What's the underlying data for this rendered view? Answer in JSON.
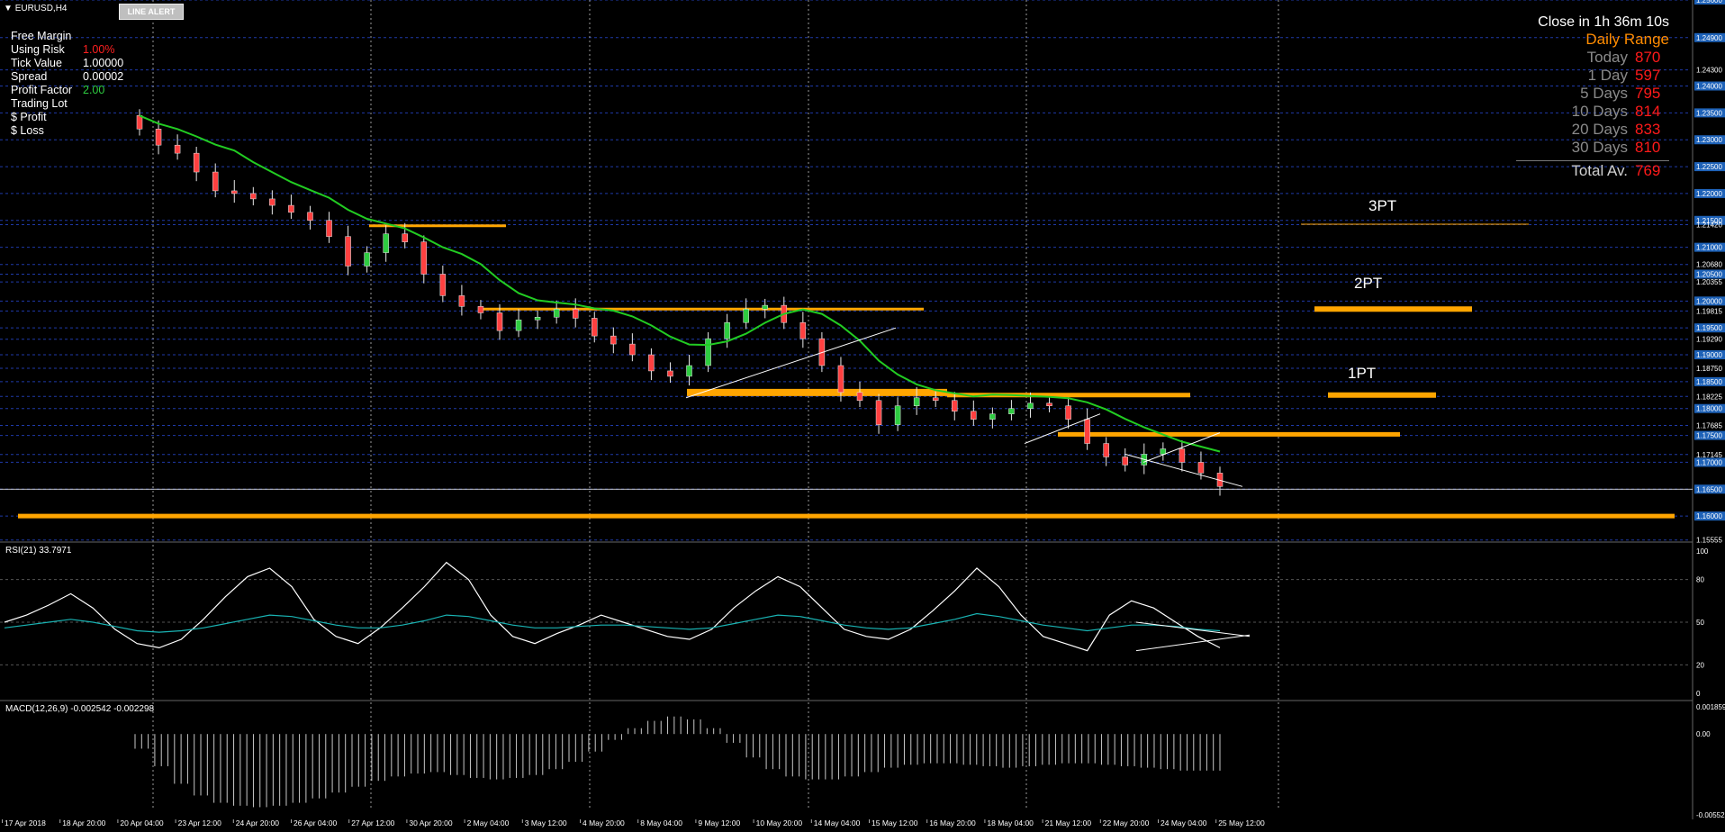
{
  "window": {
    "title": "EURUSD,H4",
    "alert_button": "LINE ALERT"
  },
  "info_panel": [
    {
      "label": "Free Margin",
      "value": ""
    },
    {
      "label": "Using Risk",
      "value": "1.00%",
      "color": "#ff2020"
    },
    {
      "label": "Tick Value",
      "value": "1.00000"
    },
    {
      "label": "Spread",
      "value": "0.00002"
    },
    {
      "label": "Profit Factor",
      "value": "2.00",
      "color": "#2ecc40"
    },
    {
      "label": "Trading Lot",
      "value": ""
    },
    {
      "label": "$ Profit",
      "value": ""
    },
    {
      "label": "$ Loss",
      "value": ""
    }
  ],
  "daily_range": {
    "close_timer": "Close in 1h 36m 10s",
    "title": "Daily Range",
    "rows": [
      {
        "label": "Today",
        "value": "870"
      },
      {
        "label": "1 Day",
        "value": "597"
      },
      {
        "label": "5 Days",
        "value": "795"
      },
      {
        "label": "10 Days",
        "value": "814"
      },
      {
        "label": "20 Days",
        "value": "833"
      },
      {
        "label": "30 Days",
        "value": "810"
      }
    ],
    "total_label": "Total Av.",
    "total_value": "769"
  },
  "targets": [
    {
      "label": "3PT",
      "price": 1.2143
    },
    {
      "label": "2PT",
      "price": 1.1985
    },
    {
      "label": "1PT",
      "price": 1.1825
    }
  ],
  "colors": {
    "up": "#2ecc40",
    "down": "#ff4040",
    "ma": "#22cc22",
    "level": "#ffa500",
    "grid": "#1f3aa8",
    "rsi": "#ffffff",
    "rsi_ma": "#19b3b3",
    "macd": "#c8c8c8"
  },
  "chart_data": [
    {
      "type": "line",
      "subtype": "candlestick",
      "symbol": "EURUSD",
      "timeframe": "H4",
      "ylim": [
        1.1555,
        1.256
      ],
      "price_ticks": [
        "1.25600",
        "1.24900",
        "1.24300",
        "1.24000",
        "1.23500",
        "1.23000",
        "1.22500",
        "1.22000",
        "1.21500",
        "1.21420",
        "1.21000",
        "1.20680",
        "1.20500",
        "1.20355",
        "1.20000",
        "1.19815",
        "1.19500",
        "1.19290",
        "1.19000",
        "1.18750",
        "1.18500",
        "1.18225",
        "1.18000",
        "1.17685",
        "1.17500",
        "1.17145",
        "1.17000",
        "1.16500",
        "1.16000",
        "1.15555"
      ],
      "current_price": "1.16500",
      "x_labels": [
        "17 Apr 2018",
        "18 Apr 20:00",
        "20 Apr 04:00",
        "23 Apr 12:00",
        "24 Apr 20:00",
        "26 Apr 04:00",
        "27 Apr 12:00",
        "30 Apr 20:00",
        "2 May 04:00",
        "3 May 12:00",
        "4 May 20:00",
        "8 May 04:00",
        "9 May 12:00",
        "10 May 20:00",
        "14 May 04:00",
        "15 May 12:00",
        "16 May 20:00",
        "18 May 04:00",
        "21 May 12:00",
        "22 May 20:00",
        "24 May 04:00",
        "25 May 12:00"
      ],
      "close_series": [
        1.232,
        1.229,
        1.2275,
        1.224,
        1.2205,
        1.22,
        1.219,
        1.2178,
        1.2165,
        1.215,
        1.212,
        1.2065,
        1.209,
        1.2125,
        1.211,
        1.205,
        1.201,
        1.199,
        1.1978,
        1.1945,
        1.1965,
        1.197,
        1.1985,
        1.1968,
        1.1935,
        1.192,
        1.19,
        1.187,
        1.186,
        1.188,
        1.193,
        1.196,
        1.1985,
        1.1992,
        1.196,
        1.193,
        1.188,
        1.183,
        1.1815,
        1.177,
        1.1805,
        1.182,
        1.1815,
        1.1795,
        1.178,
        1.179,
        1.18,
        1.181,
        1.1805,
        1.178,
        1.1735,
        1.171,
        1.1695,
        1.1715,
        1.1725,
        1.17,
        1.168,
        1.1655
      ],
      "levels": [
        {
          "name": "resistance-1",
          "price": 1.214
        },
        {
          "name": "resistance-2",
          "price": 1.1985
        },
        {
          "name": "support-1",
          "price": 1.183
        },
        {
          "name": "level-1",
          "price": 1.1825
        },
        {
          "name": "level-2",
          "price": 1.1752
        },
        {
          "name": "level-3",
          "price": 1.16
        }
      ]
    },
    {
      "type": "line",
      "title": "RSI(21) 33.7971",
      "ylim": [
        0,
        100
      ],
      "y_ticks": [
        "100",
        "80",
        "50",
        "20",
        "0"
      ],
      "series": [
        {
          "values": [
            50,
            55,
            62,
            70,
            60,
            45,
            35,
            32,
            38,
            52,
            68,
            82,
            88,
            75,
            52,
            40,
            35,
            46,
            60,
            75,
            92,
            80,
            55,
            40,
            35,
            42,
            48,
            55,
            50,
            45,
            40,
            38,
            45,
            60,
            72,
            82,
            75,
            60,
            45,
            40,
            38,
            45,
            58,
            72,
            88,
            75,
            55,
            40,
            35,
            30,
            55,
            65,
            60,
            50,
            40,
            32
          ]
        },
        {
          "values": [
            46,
            48,
            50,
            52,
            50,
            47,
            44,
            43,
            44,
            46,
            49,
            52,
            55,
            54,
            51,
            48,
            46,
            46,
            48,
            51,
            55,
            54,
            51,
            48,
            46,
            46,
            47,
            48,
            48,
            47,
            46,
            45,
            46,
            49,
            52,
            55,
            54,
            51,
            48,
            46,
            45,
            46,
            49,
            52,
            56,
            54,
            51,
            48,
            46,
            44,
            46,
            48,
            48,
            47,
            45,
            44
          ]
        }
      ]
    },
    {
      "type": "bar",
      "title": "MACD(12,26,9) -0.002542 -0.002298",
      "y_ticks": [
        "0.001859",
        "0.00",
        "-0.005527"
      ],
      "ylim": [
        -0.005527,
        0.001859
      ],
      "values": [
        -0.001,
        -0.0022,
        -0.0034,
        -0.0042,
        -0.0047,
        -0.0049,
        -0.005,
        -0.0049,
        -0.0047,
        -0.0044,
        -0.004,
        -0.0036,
        -0.0032,
        -0.0029,
        -0.0027,
        -0.0026,
        -0.0028,
        -0.003,
        -0.0031,
        -0.003,
        -0.0028,
        -0.0024,
        -0.0019,
        -0.0012,
        -0.0004,
        0.0004,
        0.0009,
        0.0012,
        0.001,
        0.0004,
        -0.0006,
        -0.0016,
        -0.0024,
        -0.0029,
        -0.0031,
        -0.0031,
        -0.0029,
        -0.0026,
        -0.0023,
        -0.0021,
        -0.002,
        -0.002,
        -0.0021,
        -0.0022,
        -0.0023,
        -0.0022,
        -0.0021,
        -0.002,
        -0.002,
        -0.0021,
        -0.0022,
        -0.0023,
        -0.0024,
        -0.0025,
        -0.0025,
        -0.0025
      ]
    }
  ]
}
